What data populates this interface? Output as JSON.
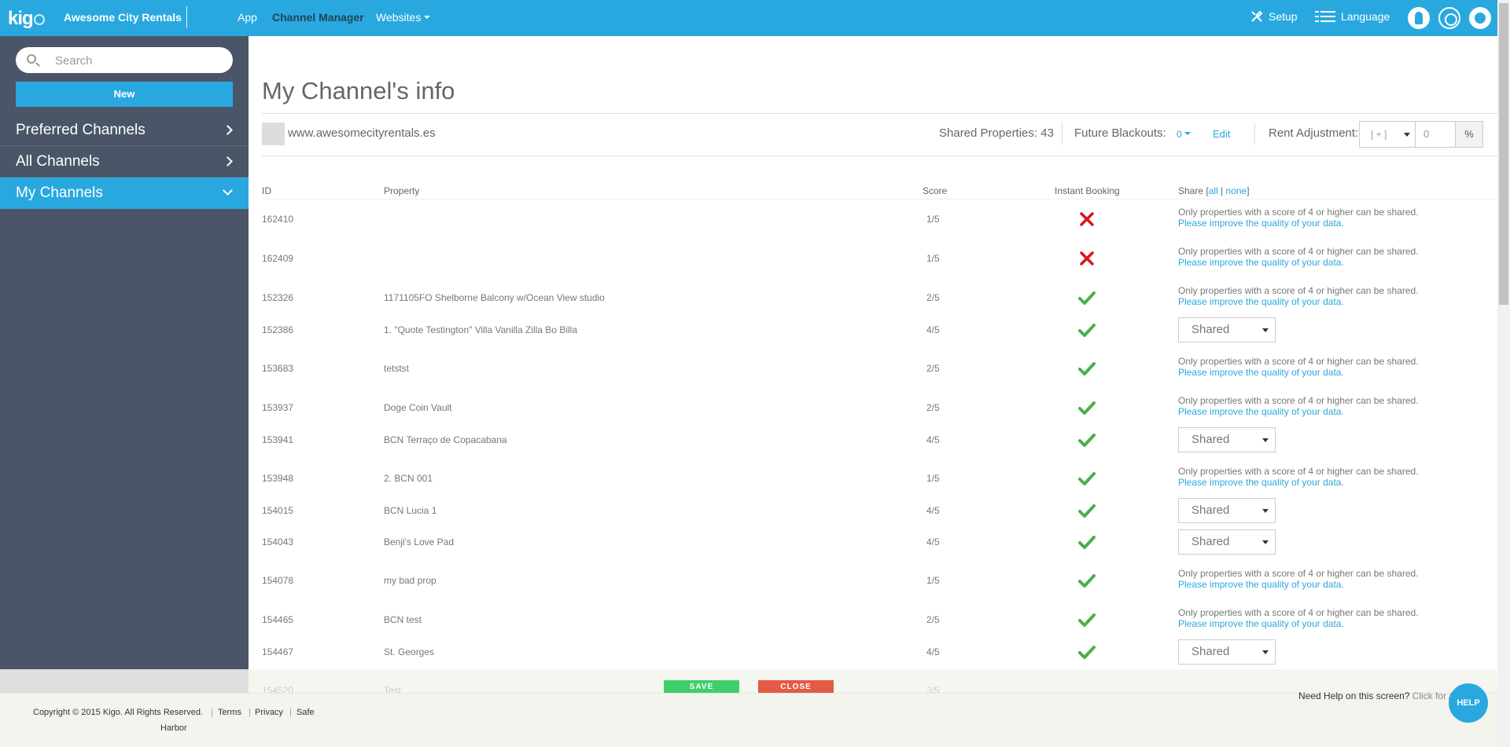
{
  "topbar": {
    "logo": "kig",
    "company": "Awesome City Rentals",
    "nav": {
      "app": "App",
      "channel_manager": "Channel Manager",
      "websites": "Websites"
    },
    "setup": "Setup",
    "language": "Language"
  },
  "sidebar": {
    "search_placeholder": "Search",
    "new_label": "New",
    "items": [
      {
        "label": "Preferred Channels"
      },
      {
        "label": "All Channels"
      },
      {
        "label": "My Channels"
      }
    ]
  },
  "main": {
    "title": "My Channel's info",
    "site_url": "www.awesomecityrentals.es",
    "shared_properties": "Shared Properties: 43",
    "future_blackouts_label": "Future Blackouts:",
    "future_blackouts_value": "0",
    "edit_label": "Edit",
    "rent_adjustment_label": "Rent Adjustment:",
    "rent_adjustment_sign": "[ + ]",
    "rent_adjustment_value": "0",
    "rent_adjustment_unit": "%"
  },
  "table": {
    "headers": {
      "id": "ID",
      "property": "Property",
      "score": "Score",
      "instant_booking": "Instant Booking",
      "share": "Share [",
      "all": "all",
      "sep": "|",
      "none": "none",
      "close": "]"
    },
    "notice": "Only properties with a score of 4 or higher can be shared.",
    "notice_link": "Please improve the quality of your data.",
    "shared_label": "Shared",
    "rows": [
      {
        "id": "162410",
        "property": "",
        "score": "1/5",
        "instant": "no",
        "shareable": false
      },
      {
        "id": "162409",
        "property": "",
        "score": "1/5",
        "instant": "no",
        "shareable": false
      },
      {
        "id": "152326",
        "property": "1171105FO Shelborne Balcony w/Ocean View studio",
        "score": "2/5",
        "instant": "yes",
        "shareable": false
      },
      {
        "id": "152386",
        "property": "1. \"Quote Testington\" Villa Vanilla Zilla Bo Billa",
        "score": "4/5",
        "instant": "yes",
        "shareable": true
      },
      {
        "id": "153683",
        "property": "tetstst",
        "score": "2/5",
        "instant": "yes",
        "shareable": false
      },
      {
        "id": "153937",
        "property": "Doge Coin Vault",
        "score": "2/5",
        "instant": "yes",
        "shareable": false
      },
      {
        "id": "153941",
        "property": "BCN Terraço de Copacabana",
        "score": "4/5",
        "instant": "yes",
        "shareable": true
      },
      {
        "id": "153948",
        "property": "2. BCN 001",
        "score": "1/5",
        "instant": "yes",
        "shareable": false
      },
      {
        "id": "154015",
        "property": "BCN Lucia 1",
        "score": "4/5",
        "instant": "yes",
        "shareable": true
      },
      {
        "id": "154043",
        "property": "Benji's Love Pad",
        "score": "4/5",
        "instant": "yes",
        "shareable": true
      },
      {
        "id": "154078",
        "property": "my bad prop",
        "score": "1/5",
        "instant": "yes",
        "shareable": false
      },
      {
        "id": "154465",
        "property": "BCN test",
        "score": "2/5",
        "instant": "yes",
        "shareable": false
      },
      {
        "id": "154467",
        "property": "St. Georges",
        "score": "4/5",
        "instant": "yes",
        "shareable": true
      }
    ],
    "partial_row": {
      "id": "154520",
      "property": "Test",
      "score": "3/5"
    }
  },
  "actions": {
    "save": "SAVE",
    "close": "CLOSE"
  },
  "footer": {
    "copyright": "Copyright © 2015 Kigo. All Rights Reserved.",
    "terms": "Terms",
    "privacy": "Privacy",
    "safe": "Safe",
    "harbor": "Harbor",
    "help_prompt": "Need Help on this screen?",
    "help_link": "Click for A",
    "help_button": "HELP"
  },
  "colors": {
    "brand": "#29a8e0",
    "sidebar": "#4a5567",
    "check": "#4cae4c",
    "cross": "#d9141c",
    "save": "#3fcf6a",
    "close": "#e35a45"
  }
}
